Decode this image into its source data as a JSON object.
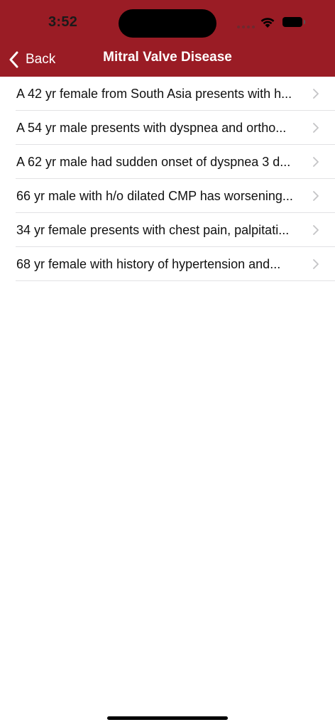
{
  "status_bar": {
    "time": "3:52",
    "icons": [
      "cellular-signal-icon",
      "wifi-icon",
      "battery-icon"
    ]
  },
  "nav": {
    "back_label": "Back",
    "title": "Mitral Valve Disease"
  },
  "cases": [
    {
      "label": "A 42 yr female from South Asia presents with h..."
    },
    {
      "label": "A 54 yr male presents with dyspnea and ortho..."
    },
    {
      "label": "A 62 yr male had sudden onset of dyspnea 3 d..."
    },
    {
      "label": "66 yr male with h/o dilated CMP has worsening..."
    },
    {
      "label": "34 yr female presents with chest pain, palpitati..."
    },
    {
      "label": "68 yr female with history of hypertension and..."
    }
  ],
  "colors": {
    "header_background": "#9a1c25",
    "header_text": "#ffffff",
    "separator": "#e2e2e4",
    "chevron": "#c4c4c6"
  }
}
